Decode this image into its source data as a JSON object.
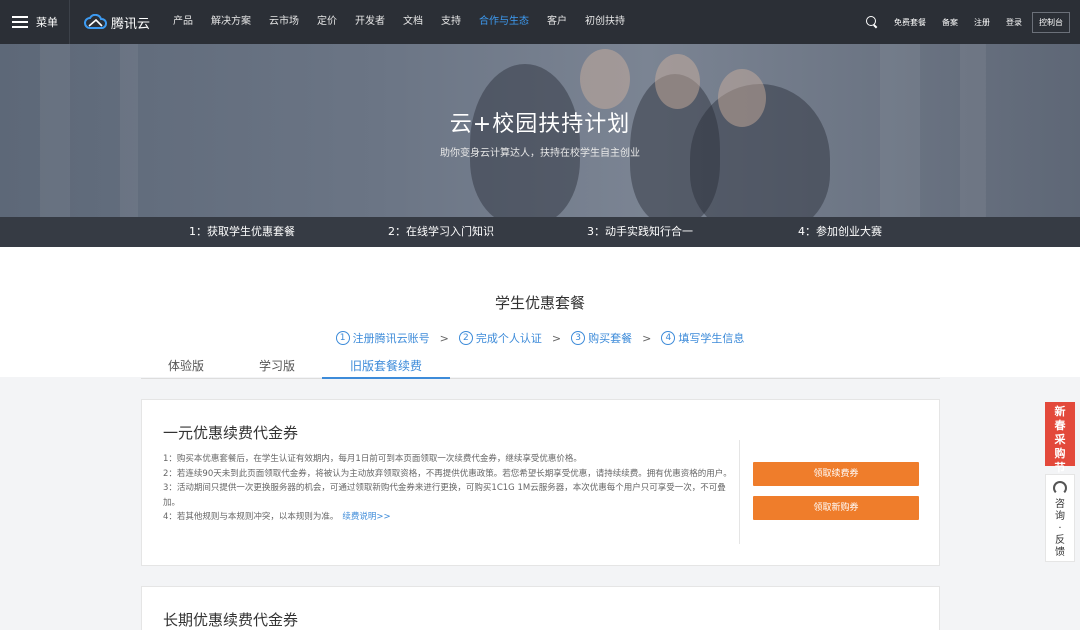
{
  "nav": {
    "menu_label": "菜单",
    "logo_text": "腾讯云",
    "items": [
      "产品",
      "解决方案",
      "云市场",
      "定价",
      "开发者",
      "文档",
      "支持",
      "合作与生态",
      "客户",
      "初创扶持"
    ],
    "active_item": "合作与生态",
    "right": {
      "free_package": "免费套餐",
      "record": "备案",
      "register": "注册",
      "login": "登录",
      "console": "控制台"
    }
  },
  "banner": {
    "title": "云+校园扶持计划",
    "subtitle": "助你变身云计算达人，扶持在校学生自主创业",
    "steps": [
      "1：获取学生优惠套餐",
      "2：在线学习入门知识",
      "3：动手实践知行合一",
      "4：参加创业大赛"
    ]
  },
  "main": {
    "section_title": "学生优惠套餐",
    "flow": [
      {
        "num": "1",
        "label": "注册腾讯云账号"
      },
      {
        "num": "2",
        "label": "完成个人认证"
      },
      {
        "num": "3",
        "label": "购买套餐"
      },
      {
        "num": "4",
        "label": "填写学生信息"
      }
    ],
    "flow_arrow": ">",
    "tabs": [
      "体验版",
      "学习版",
      "旧版套餐续费"
    ],
    "active_tab": "旧版套餐续费"
  },
  "card1": {
    "title": "一元优惠续费代金券",
    "rules": [
      "1：购买本优惠套餐后，在学生认证有效期内，每月1日前可到本页面领取一次续费代金券，继续享受优惠价格。",
      "2：若连续90天未到此页面领取代金券，将被认为主动放弃领取资格，不再提供优惠政策。若您希望长期享受优惠，请持续续费。拥有优惠资格的用户。",
      "3：活动期间只提供一次更换服务器的机会，可通过领取新购代金券来进行更换，可购买1C1G 1M云服务器，本次优惠每个用户只可享受一次，不可叠加。",
      "4：若其他规则与本规则冲突，以本规则为准。"
    ],
    "link": "续费说明>>",
    "btn_renew": "领取续费券",
    "btn_new": "领取新购券"
  },
  "card2": {
    "title": "长期优惠续费代金券"
  },
  "side": {
    "promo": [
      "新",
      "春",
      "采",
      "购",
      "节"
    ],
    "feedback": [
      "咨",
      "询",
      "·",
      "反",
      "馈"
    ]
  },
  "colors": {
    "nav_bg": "#2b2f36",
    "accent_blue": "#3d8bd9",
    "button_orange": "#ef7d2b",
    "promo_red": "#e3493b"
  }
}
